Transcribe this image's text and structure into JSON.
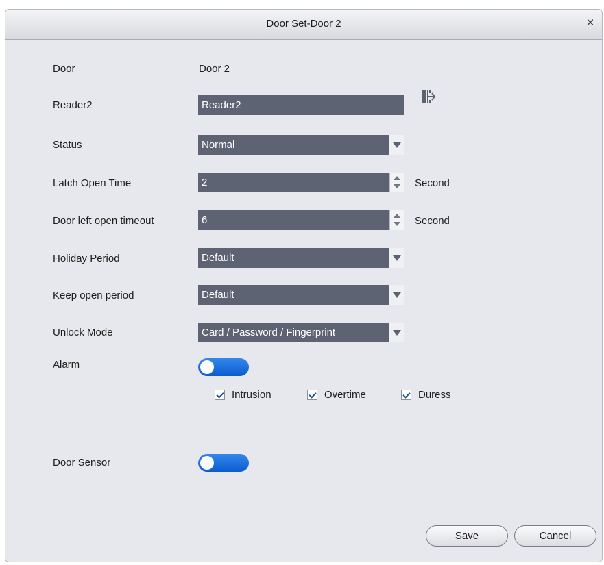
{
  "dialog": {
    "title": "Door Set-Door 2",
    "close_glyph": "×"
  },
  "door": {
    "label": "Door",
    "value": "Door 2"
  },
  "reader": {
    "label": "Reader2",
    "value": "Reader2",
    "icon": "exit-door-icon"
  },
  "status": {
    "label": "Status",
    "value": "Normal"
  },
  "latch_open_time": {
    "label": "Latch Open Time",
    "value": "2",
    "unit": "Second"
  },
  "door_left_open_timeout": {
    "label": "Door left open timeout",
    "value": "6",
    "unit": "Second"
  },
  "holiday_period": {
    "label": "Holiday Period",
    "value": "Default"
  },
  "keep_open_period": {
    "label": "Keep open period",
    "value": "Default"
  },
  "unlock_mode": {
    "label": "Unlock Mode",
    "value": "Card / Password / Fingerprint"
  },
  "alarm": {
    "label": "Alarm",
    "enabled": false,
    "options": [
      {
        "label": "Intrusion",
        "checked": true
      },
      {
        "label": "Overtime",
        "checked": true
      },
      {
        "label": "Duress",
        "checked": true
      }
    ]
  },
  "door_sensor": {
    "label": "Door Sensor",
    "enabled": false
  },
  "buttons": {
    "save": "Save",
    "cancel": "Cancel"
  },
  "colors": {
    "field_bg": "#5d6372",
    "toggle_blue": "#1a6fe0",
    "dialog_bg": "#e7e8ed"
  }
}
